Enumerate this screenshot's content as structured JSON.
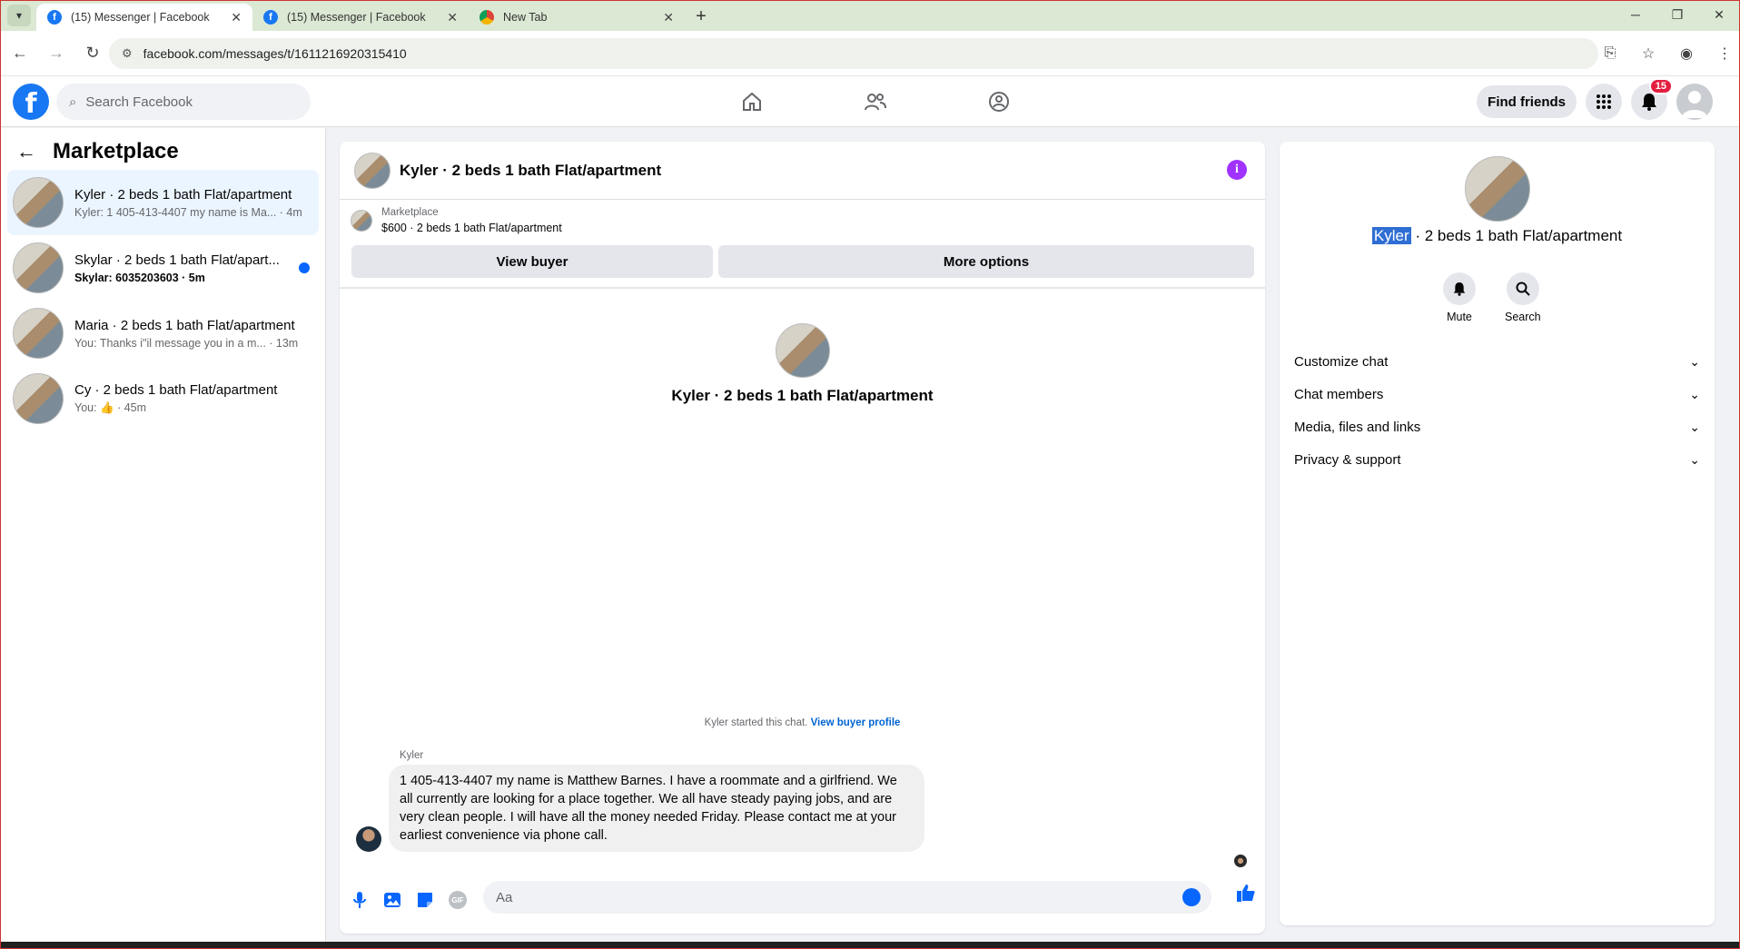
{
  "browser": {
    "tabs": [
      {
        "title": "(15) Messenger | Facebook",
        "active": true
      },
      {
        "title": "(15) Messenger | Facebook",
        "active": false
      },
      {
        "title": "New Tab",
        "active": false
      }
    ],
    "url": "facebook.com/messages/t/1611216920315410"
  },
  "header": {
    "search_placeholder": "Search Facebook",
    "find_friends": "Find friends",
    "notification_count": "15"
  },
  "sidebar": {
    "title": "Marketplace",
    "conversations": [
      {
        "name": "Kyler · 2 beds 1 bath Flat/apartment",
        "preview": "Kyler: 1 405-413-4407 my name is Ma... · 4m",
        "active": true,
        "unread": false
      },
      {
        "name": "Skylar · 2 beds 1 bath Flat/apart...",
        "preview": "Skylar: 6035203603 · 5m",
        "active": false,
        "unread": true
      },
      {
        "name": "Maria · 2 beds 1 bath Flat/apartment",
        "preview": "You: Thanks i\"il message you in a m... · 13m",
        "active": false,
        "unread": false
      },
      {
        "name": "Cy · 2 beds 1 bath Flat/apartment",
        "preview": "You: 👍 · 45m",
        "active": false,
        "unread": false
      }
    ]
  },
  "chat": {
    "title": "Kyler · 2 beds 1 bath Flat/apartment",
    "listing_source": "Marketplace",
    "listing_title": "$600 · 2 beds 1 bath Flat/apartment",
    "view_buyer": "View buyer",
    "more_options": "More options",
    "center_name": "Kyler · 2 beds 1 bath Flat/apartment",
    "started_text": "Kyler started this chat.",
    "buyer_profile_link": "View buyer profile",
    "sender": "Kyler",
    "message": "1 405-413-4407 my name is Matthew Barnes. I have a roommate and a girlfriend. We all currently are looking for a place together. We all have steady paying jobs, and are very clean people. I will have all the money needed Friday. Please contact me at your earliest convenience via phone call.",
    "input_placeholder": "Aa"
  },
  "details": {
    "name_highlight": "Kyler",
    "name_rest": " · 2 beds 1 bath Flat/apartment",
    "mute": "Mute",
    "search": "Search",
    "sections": [
      "Customize chat",
      "Chat members",
      "Media, files and links",
      "Privacy & support"
    ]
  }
}
